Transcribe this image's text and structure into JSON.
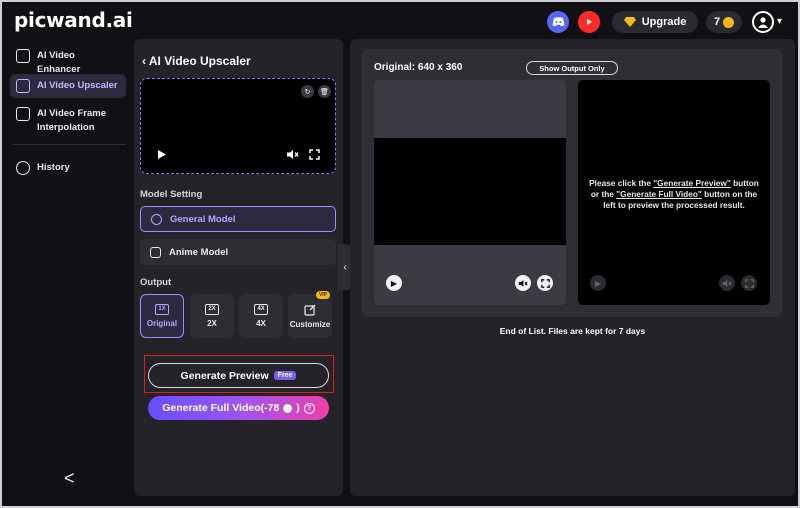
{
  "header": {
    "logo_main": "picwand",
    "logo_dot": ".",
    "logo_suffix": "ai",
    "upgrade_label": "Upgrade",
    "coins": "7"
  },
  "sidebar": {
    "items": [
      {
        "label": "AI Video Enhancer",
        "icon": "enhance-icon"
      },
      {
        "label": "AI Video Upscaler",
        "icon": "upscale-icon"
      },
      {
        "label": "AI Video Frame Interpolation",
        "icon": "frame-icon"
      },
      {
        "label": "History",
        "icon": "history-icon"
      }
    ],
    "collapse_glyph": "<"
  },
  "panel": {
    "title": "AI Video Upscaler",
    "model_setting_label": "Model Setting",
    "models": [
      "General Model",
      "Anime Model"
    ],
    "output_label": "Output",
    "outputs": [
      {
        "icon_text": "1X",
        "label": "Original"
      },
      {
        "icon_text": "2X",
        "label": "2X"
      },
      {
        "icon_text": "4X",
        "label": "4X"
      },
      {
        "icon_text": "",
        "label": "Customize",
        "badge": "VIP"
      }
    ],
    "generate_preview": "Generate Preview",
    "free_badge": "Free",
    "generate_full": "Generate Full Video(-78",
    "generate_full_suffix": ")",
    "help_glyph": "?"
  },
  "main": {
    "original_label": "Original: 640 x 360",
    "show_output_only": "Show Output Only",
    "message_prefix": "Please click the ",
    "message_link1": "\"Generate Preview\"",
    "message_mid": " button or the ",
    "message_link2": "\"Generate Full Video\"",
    "message_suffix": " button on the left to preview the processed result.",
    "end_of_list": "End of List. Files are kept for 7 days"
  },
  "colors": {
    "accent": "#a48bff",
    "background": "#111115",
    "panel": "#232329"
  }
}
